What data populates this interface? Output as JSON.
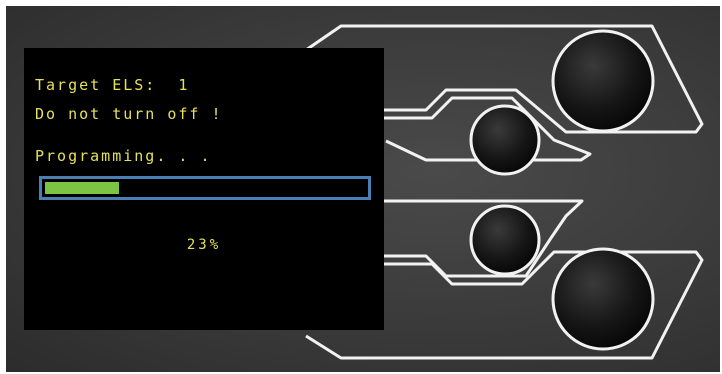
{
  "colors": {
    "text": "#e6e05a",
    "progress_fill": "#7cc443",
    "progress_border": "#4a7fb4",
    "screen_bg": "#000000"
  },
  "screen": {
    "target_line": "Target ELS:  1",
    "warning_line": "Do not turn off !",
    "status_line": "Programming. . .",
    "progress_fraction": 0.23,
    "percent_label": "23%"
  }
}
